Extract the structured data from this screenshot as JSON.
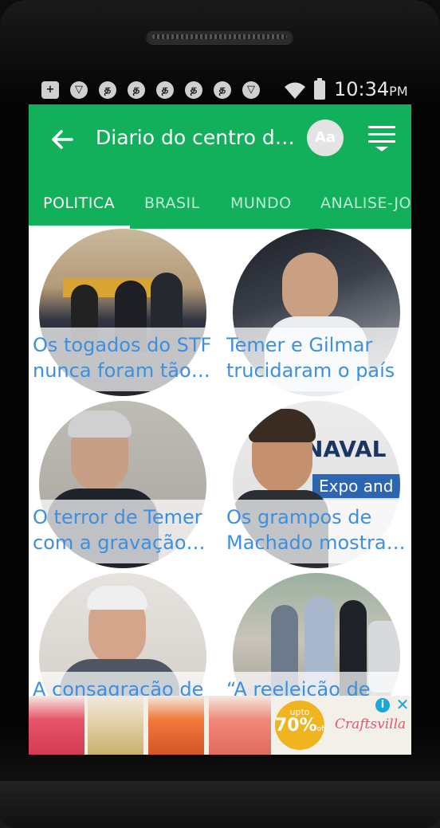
{
  "status_bar": {
    "time": "10:34",
    "ampm": "PM",
    "icons": [
      "plus-square-icon",
      "shield-icon",
      "tamil-glyph-icon",
      "tamil-glyph-icon",
      "tamil-glyph-icon",
      "tamil-glyph-icon",
      "tamil-glyph-icon",
      "shield-icon",
      "wifi-icon",
      "battery-icon"
    ]
  },
  "toolbar": {
    "title": "Diario do centro do mundo",
    "font_button": "Aa",
    "back_icon": "arrow-left-icon",
    "menu_icon": "hamburger-menu-icon"
  },
  "tabs": [
    {
      "label": "POLITICA",
      "active": true
    },
    {
      "label": "BRASIL",
      "active": false
    },
    {
      "label": "MUNDO",
      "active": false
    },
    {
      "label": "ANALISE-JORNAL",
      "active": false
    }
  ],
  "articles": [
    {
      "title": "Os togados do STF nunca foram tão honrados"
    },
    {
      "title": "Temer e Gilmar trucidaram o país"
    },
    {
      "title": "O terror de Temer com a gravação de Machado"
    },
    {
      "title": "Os grampos de Machado mostram tudo"
    },
    {
      "title": "A consagração de FHC"
    },
    {
      "title": "“A reeleição de Dilma”"
    }
  ],
  "ad": {
    "badge_top": "upto",
    "badge_value": "70%",
    "badge_suffix": "off",
    "brand": "Craftsvilla",
    "info_icon": "info-icon",
    "close_icon": "close-icon",
    "accent": "#f0b41e"
  },
  "colors": {
    "primary": "#12b05a",
    "link": "#3d8fe0"
  }
}
